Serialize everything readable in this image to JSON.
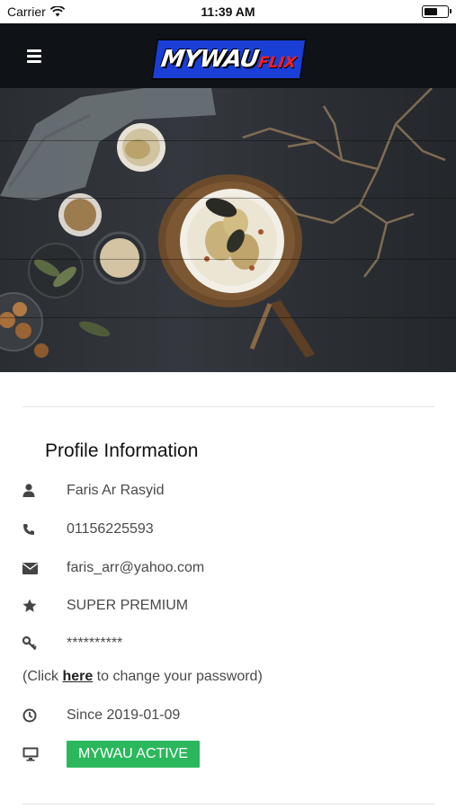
{
  "status_bar": {
    "carrier": "Carrier",
    "time": "11:39 AM",
    "battery_level": 0.6
  },
  "header": {
    "logo_main": "MYWAU",
    "logo_sub": "FLIX"
  },
  "profile": {
    "title": "Profile Information",
    "name": "Faris Ar Rasyid",
    "phone": "01156225593",
    "email": "faris_arr@yahoo.com",
    "membership": "SUPER PREMIUM",
    "password_mask": "**********",
    "password_note_prefix": "(Click ",
    "password_note_link": "here",
    "password_note_suffix": " to change your password)",
    "since": "Since 2019-01-09",
    "status_badge": "MYWAU ACTIVE"
  },
  "colors": {
    "header_bg": "#0f1216",
    "badge": "#2bb85c",
    "logo_blue": "#1a3fd6",
    "logo_red": "#ff1f1f"
  },
  "icons": [
    "menu-icon",
    "wifi-icon",
    "battery-icon",
    "user-icon",
    "phone-icon",
    "envelope-icon",
    "star-icon",
    "key-icon",
    "clock-icon",
    "desktop-icon"
  ]
}
